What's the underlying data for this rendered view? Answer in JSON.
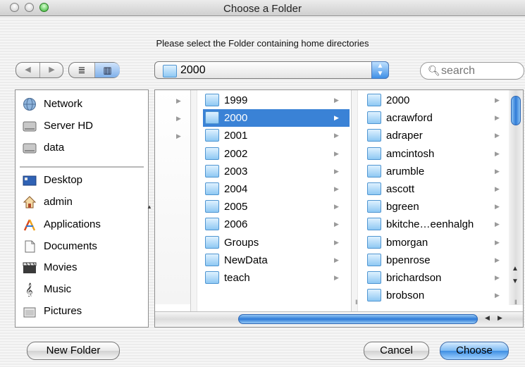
{
  "window": {
    "title": "Choose a Folder"
  },
  "prompt": "Please select the Folder containing home directories",
  "toolbar": {
    "back_icon": "◀",
    "forward_icon": "▶",
    "list_view_icon": "≣",
    "column_view_icon": "▥",
    "path_popup": "2000",
    "search_placeholder": "search"
  },
  "sidebar": {
    "devices": [
      {
        "label": "Network",
        "icon": "network-globe-icon"
      },
      {
        "label": "Server HD",
        "icon": "hard-drive-icon"
      },
      {
        "label": "data",
        "icon": "hard-drive-icon"
      }
    ],
    "places": [
      {
        "label": "Desktop",
        "icon": "desktop-icon"
      },
      {
        "label": "admin",
        "icon": "home-icon"
      },
      {
        "label": "Applications",
        "icon": "applications-icon"
      },
      {
        "label": "Documents",
        "icon": "documents-icon"
      },
      {
        "label": "Movies",
        "icon": "movies-icon"
      },
      {
        "label": "Music",
        "icon": "music-icon"
      },
      {
        "label": "Pictures",
        "icon": "pictures-icon"
      }
    ]
  },
  "browser": {
    "column1": {
      "items": [
        "1999",
        "2000",
        "2001",
        "2002",
        "2003",
        "2004",
        "2005",
        "2006",
        "Groups",
        "NewData",
        "teach"
      ],
      "selected": "2000"
    },
    "column2": {
      "items": [
        "2000",
        "acrawford",
        "adraper",
        "amcintosh",
        "arumble",
        "ascott",
        "bgreen",
        "bkitche…eenhalgh",
        "bmorgan",
        "bpenrose",
        "brichardson",
        "brobson"
      ]
    }
  },
  "buttons": {
    "new_folder": "New Folder",
    "cancel": "Cancel",
    "choose": "Choose"
  },
  "colors": {
    "selection": "#3a82d6",
    "default_button": "#4a97e8",
    "folder": "#8ec8f3"
  }
}
